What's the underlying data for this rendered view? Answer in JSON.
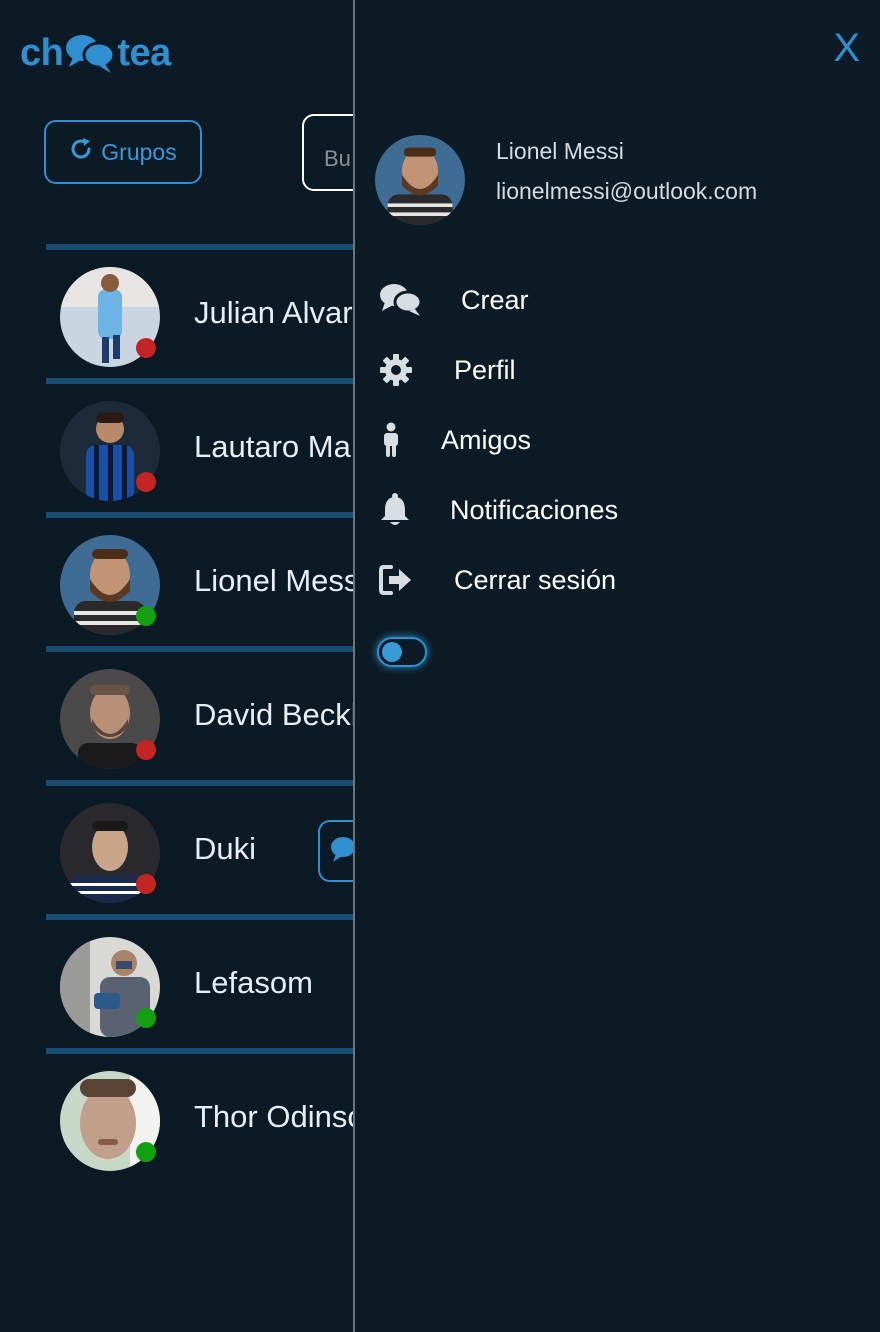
{
  "app": {
    "logo_left": "ch",
    "logo_right": "tea"
  },
  "toolbar": {
    "groups_label": "Grupos",
    "search_placeholder": "Bu"
  },
  "contacts": [
    {
      "name": "Julian Alvarez",
      "status": "offline",
      "status_color": "#c42424"
    },
    {
      "name": "Lautaro Martinez",
      "status": "offline",
      "status_color": "#c42424"
    },
    {
      "name": "Lionel Messi",
      "status": "online",
      "status_color": "#12a012"
    },
    {
      "name": "David Beckham",
      "status": "offline",
      "status_color": "#c42424"
    },
    {
      "name": "Duki",
      "status": "offline",
      "status_color": "#c42424",
      "has_chat_button": true
    },
    {
      "name": "Lefasom",
      "status": "online",
      "status_color": "#12a012"
    },
    {
      "name": "Thor Odinson",
      "status": "online",
      "status_color": "#12a012"
    }
  ],
  "drawer": {
    "close_label": "X",
    "user": {
      "name": "Lionel Messi",
      "email": "lionelmessi@outlook.com"
    },
    "menu": [
      {
        "label": "Crear",
        "icon": "chat-bubbles-icon"
      },
      {
        "label": "Perfil",
        "icon": "gear-icon"
      },
      {
        "label": "Amigos",
        "icon": "person-icon"
      },
      {
        "label": "Notificaciones",
        "icon": "bell-icon"
      },
      {
        "label": "Cerrar sesión",
        "icon": "sign-out-icon"
      }
    ],
    "theme_toggle": {
      "checked": false
    }
  },
  "colors": {
    "accent": "#2f8fd0",
    "background": "#0b1a25",
    "divider": "#184c72",
    "offline": "#c42424",
    "online": "#12a012"
  }
}
